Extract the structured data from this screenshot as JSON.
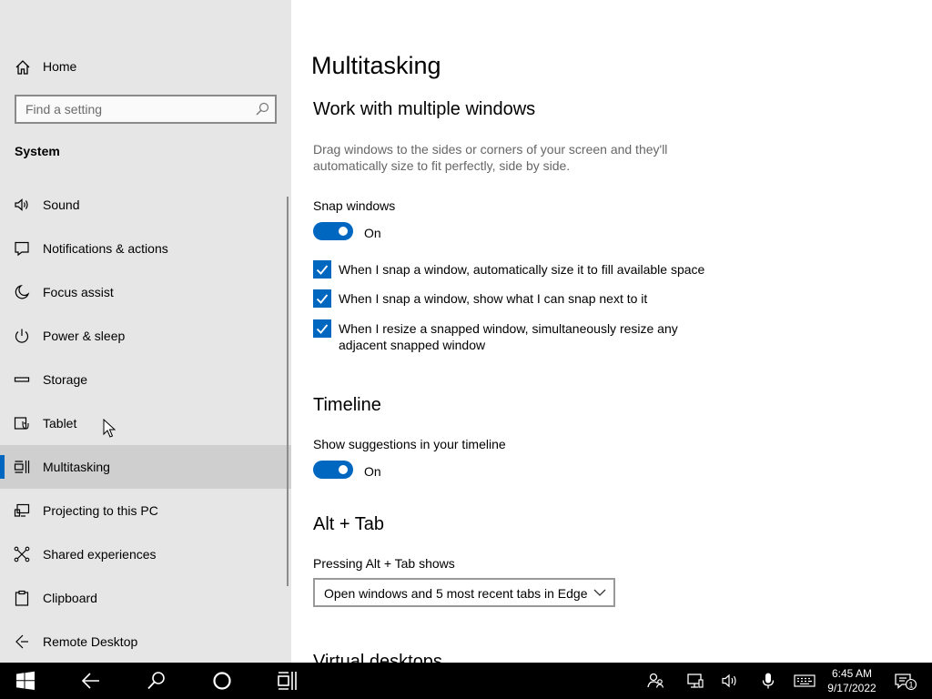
{
  "sidebar": {
    "home_label": "Home",
    "search_placeholder": "Find a setting",
    "section_title": "System",
    "items": [
      {
        "label": "Sound",
        "icon": "speaker-icon"
      },
      {
        "label": "Notifications & actions",
        "icon": "notification-icon"
      },
      {
        "label": "Focus assist",
        "icon": "moon-icon"
      },
      {
        "label": "Power & sleep",
        "icon": "power-icon"
      },
      {
        "label": "Storage",
        "icon": "storage-icon"
      },
      {
        "label": "Tablet",
        "icon": "tablet-icon"
      },
      {
        "label": "Multitasking",
        "icon": "multitasking-icon",
        "active": true
      },
      {
        "label": "Projecting to this PC",
        "icon": "projecting-icon"
      },
      {
        "label": "Shared experiences",
        "icon": "shared-experiences-icon"
      },
      {
        "label": "Clipboard",
        "icon": "clipboard-icon"
      },
      {
        "label": "Remote Desktop",
        "icon": "remote-desktop-icon"
      }
    ]
  },
  "main": {
    "title": "Multitasking",
    "windows_section": {
      "heading": "Work with multiple windows",
      "description": "Drag windows to the sides or corners of your screen and they'll automatically size to fit perfectly, side by side.",
      "snap_label": "Snap windows",
      "snap_state": "On",
      "options": [
        "When I snap a window, automatically size it to fill available space",
        "When I snap a window, show what I can snap next to it",
        "When I resize a snapped window, simultaneously resize any adjacent snapped window"
      ]
    },
    "timeline_section": {
      "heading": "Timeline",
      "label": "Show suggestions in your timeline",
      "state": "On"
    },
    "alttab_section": {
      "heading": "Alt + Tab",
      "label": "Pressing Alt + Tab shows",
      "selected": "Open windows and 5 most recent tabs in Edge"
    },
    "partial_heading": "Virtual desktops"
  },
  "taskbar": {
    "time": "6:45 AM",
    "date": "9/17/2022",
    "notification_count": "1"
  },
  "colors": {
    "accent": "#0067c0",
    "sidebar_bg": "#e6e6e6",
    "active_item_bg": "#cfcfcf",
    "taskbar_bg": "#000000"
  }
}
